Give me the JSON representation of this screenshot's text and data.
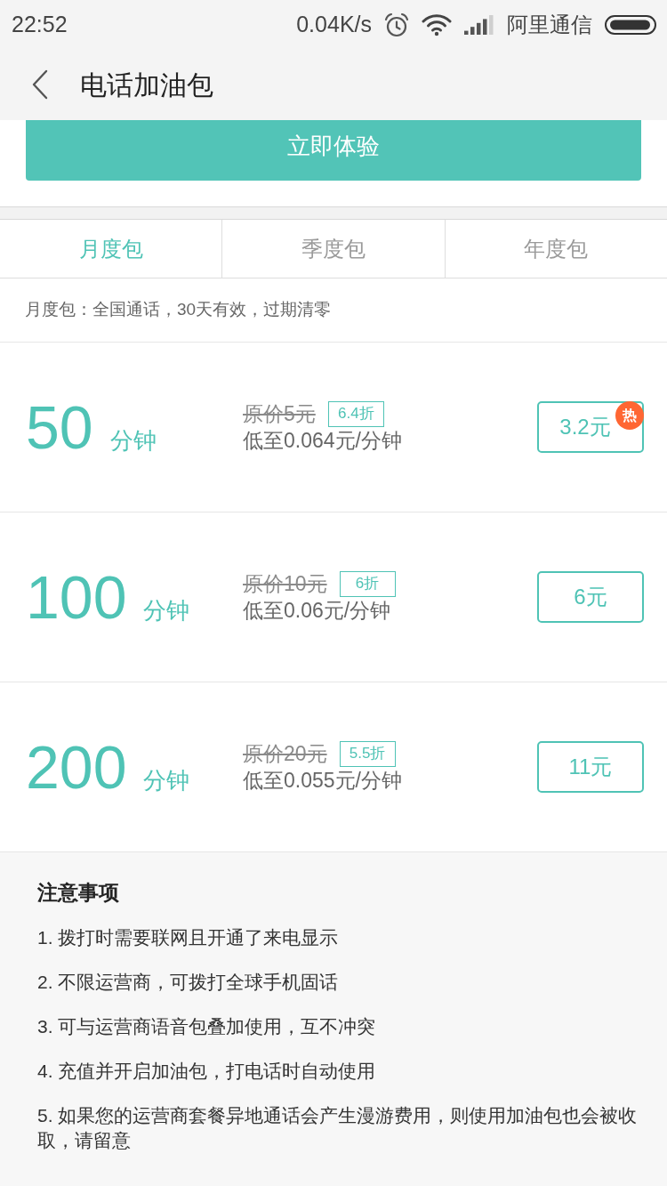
{
  "status_bar": {
    "time": "22:52",
    "network_speed": "0.04K/s",
    "carrier": "阿里通信"
  },
  "header": {
    "title": "电话加油包"
  },
  "primary_button": {
    "label": "立即体验"
  },
  "tabs": [
    {
      "label": "月度包",
      "selected": true
    },
    {
      "label": "季度包",
      "selected": false
    },
    {
      "label": "年度包",
      "selected": false
    }
  ],
  "description": "月度包：全国通话，30天有效，过期清零",
  "packages": [
    {
      "minutes": "50",
      "unit": "分钟",
      "original_price": "原价5元",
      "discount": "6.4折",
      "unit_price": "低至0.064元/分钟",
      "price": "3.2元",
      "badge": "热"
    },
    {
      "minutes": "100",
      "unit": "分钟",
      "original_price": "原价10元",
      "discount": "6折",
      "unit_price": "低至0.06元/分钟",
      "price": "6元"
    },
    {
      "minutes": "200",
      "unit": "分钟",
      "original_price": "原价20元",
      "discount": "5.5折",
      "unit_price": "低至0.055元/分钟",
      "price": "11元"
    }
  ],
  "notes": {
    "title": "注意事项",
    "items": [
      "1. 拨打时需要联网且开通了来电显示",
      "2. 不限运营商，可拨打全球手机固话",
      "3. 可与运营商语音包叠加使用，互不冲突",
      "4. 充值并开启加油包，打电话时自动使用",
      "5. 如果您的运营商套餐异地通话会产生漫游费用，则使用加油包也会被收取，请留意"
    ]
  }
}
